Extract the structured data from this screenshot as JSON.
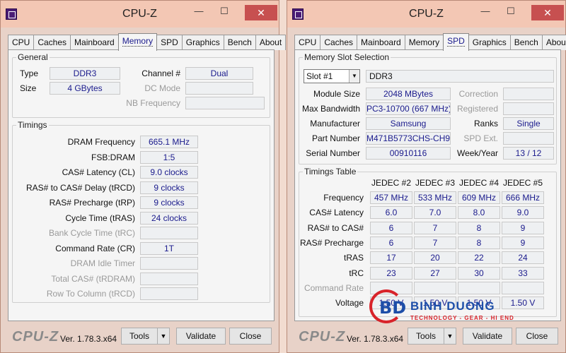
{
  "window_title": "CPU-Z",
  "titlebar": {
    "minimize": "—",
    "maximize": "☐",
    "close": "✕"
  },
  "tabs": [
    "CPU",
    "Caches",
    "Mainboard",
    "Memory",
    "SPD",
    "Graphics",
    "Bench",
    "About"
  ],
  "memory": {
    "general": {
      "legend": "General",
      "type_label": "Type",
      "type_value": "DDR3",
      "size_label": "Size",
      "size_value": "4 GBytes",
      "channel_label": "Channel #",
      "channel_value": "Dual",
      "dc_mode_label": "DC Mode",
      "dc_mode_value": "",
      "nb_freq_label": "NB Frequency",
      "nb_freq_value": ""
    },
    "timings": {
      "legend": "Timings",
      "rows": [
        {
          "label": "DRAM Frequency",
          "value": "665.1 MHz",
          "dim": false
        },
        {
          "label": "FSB:DRAM",
          "value": "1:5",
          "dim": false
        },
        {
          "label": "CAS# Latency (CL)",
          "value": "9.0 clocks",
          "dim": false
        },
        {
          "label": "RAS# to CAS# Delay (tRCD)",
          "value": "9 clocks",
          "dim": false
        },
        {
          "label": "RAS# Precharge (tRP)",
          "value": "9 clocks",
          "dim": false
        },
        {
          "label": "Cycle Time (tRAS)",
          "value": "24 clocks",
          "dim": false
        },
        {
          "label": "Bank Cycle Time (tRC)",
          "value": "",
          "dim": true
        },
        {
          "label": "Command Rate (CR)",
          "value": "1T",
          "dim": false
        },
        {
          "label": "DRAM Idle Timer",
          "value": "",
          "dim": true
        },
        {
          "label": "Total CAS# (tRDRAM)",
          "value": "",
          "dim": true
        },
        {
          "label": "Row To Column (tRCD)",
          "value": "",
          "dim": true
        }
      ]
    }
  },
  "spd": {
    "slot": {
      "legend": "Memory Slot Selection",
      "slot_value": "Slot #1",
      "type_value": "DDR3",
      "module_size_label": "Module Size",
      "module_size_value": "2048 MBytes",
      "max_bw_label": "Max Bandwidth",
      "max_bw_value": "PC3-10700 (667 MHz)",
      "manufacturer_label": "Manufacturer",
      "manufacturer_value": "Samsung",
      "part_label": "Part Number",
      "part_value": "M471B5773CHS-CH9",
      "serial_label": "Serial Number",
      "serial_value": "00910116",
      "correction_label": "Correction",
      "correction_value": "",
      "registered_label": "Registered",
      "registered_value": "",
      "ranks_label": "Ranks",
      "ranks_value": "Single",
      "spd_ext_label": "SPD Ext.",
      "spd_ext_value": "",
      "week_year_label": "Week/Year",
      "week_year_value": "13 / 12"
    },
    "timings_table": {
      "legend": "Timings Table",
      "columns": [
        "JEDEC #2",
        "JEDEC #3",
        "JEDEC #4",
        "JEDEC #5"
      ],
      "rows": [
        {
          "label": "Frequency",
          "dim": false,
          "values": [
            "457 MHz",
            "533 MHz",
            "609 MHz",
            "666 MHz"
          ]
        },
        {
          "label": "CAS# Latency",
          "dim": false,
          "values": [
            "6.0",
            "7.0",
            "8.0",
            "9.0"
          ]
        },
        {
          "label": "RAS# to CAS#",
          "dim": false,
          "values": [
            "6",
            "7",
            "8",
            "9"
          ]
        },
        {
          "label": "RAS# Precharge",
          "dim": false,
          "values": [
            "6",
            "7",
            "8",
            "9"
          ]
        },
        {
          "label": "tRAS",
          "dim": false,
          "values": [
            "17",
            "20",
            "22",
            "24"
          ]
        },
        {
          "label": "tRC",
          "dim": false,
          "values": [
            "23",
            "27",
            "30",
            "33"
          ]
        },
        {
          "label": "Command Rate",
          "dim": true,
          "values": [
            "",
            "",
            "",
            ""
          ]
        },
        {
          "label": "Voltage",
          "dim": false,
          "values": [
            "1.50 V",
            "1.50 V",
            "1.50 V",
            "1.50 V"
          ]
        }
      ]
    }
  },
  "footer": {
    "logo": "CPU-Z",
    "version": "Ver. 1.78.3.x64",
    "tools_label": "Tools",
    "validate_label": "Validate",
    "close_label": "Close"
  },
  "watermark": {
    "mark": "BD",
    "name": "BINH DUONG",
    "tagline": "TECHNOLOGY - GEAR - HI END"
  }
}
